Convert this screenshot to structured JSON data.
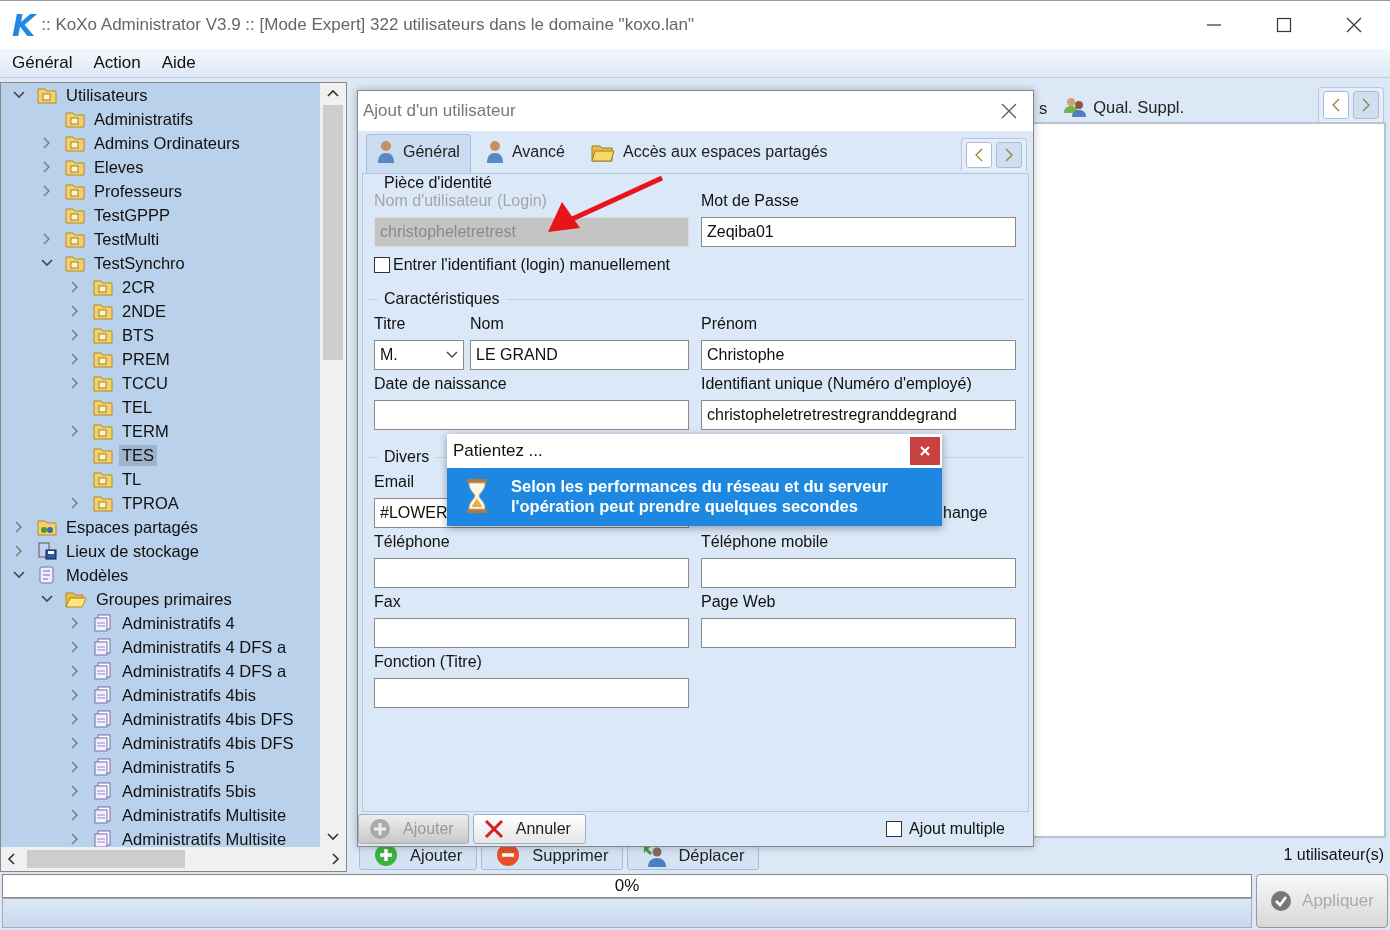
{
  "window": {
    "logo": "K",
    "title": ":: KoXo Administrator V3.9 :: [Mode Expert] 322 utilisateurs dans le domaine \"koxo.lan\""
  },
  "menu": [
    "Général",
    "Action",
    "Aide"
  ],
  "tree": [
    {
      "label": "Utilisateurs",
      "kind": "ou",
      "has_children": true,
      "expanded": true,
      "selected": false,
      "children": [
        {
          "label": "Administratifs",
          "kind": "ou",
          "has_children": false,
          "selected": false
        },
        {
          "label": "Admins Ordinateurs",
          "kind": "ou",
          "has_children": true,
          "expanded": false,
          "selected": false
        },
        {
          "label": "Eleves",
          "kind": "ou",
          "has_children": true,
          "expanded": false,
          "selected": false
        },
        {
          "label": "Professeurs",
          "kind": "ou",
          "has_children": true,
          "expanded": false,
          "selected": false
        },
        {
          "label": "TestGPPP",
          "kind": "ou",
          "has_children": false,
          "selected": false
        },
        {
          "label": "TestMulti",
          "kind": "ou",
          "has_children": true,
          "expanded": false,
          "selected": false
        },
        {
          "label": "TestSynchro",
          "kind": "ou",
          "has_children": true,
          "expanded": true,
          "selected": false,
          "children": [
            {
              "label": "2CR",
              "kind": "ou",
              "has_children": true,
              "expanded": false,
              "selected": false
            },
            {
              "label": "2NDE",
              "kind": "ou",
              "has_children": true,
              "expanded": false,
              "selected": false
            },
            {
              "label": "BTS",
              "kind": "ou",
              "has_children": true,
              "expanded": false,
              "selected": false
            },
            {
              "label": "PREM",
              "kind": "ou",
              "has_children": true,
              "expanded": false,
              "selected": false
            },
            {
              "label": "TCCU",
              "kind": "ou",
              "has_children": true,
              "expanded": false,
              "selected": false
            },
            {
              "label": "TEL",
              "kind": "ou",
              "has_children": false,
              "selected": false
            },
            {
              "label": "TERM",
              "kind": "ou",
              "has_children": true,
              "expanded": false,
              "selected": false
            },
            {
              "label": "TES",
              "kind": "ou",
              "has_children": false,
              "selected": true
            },
            {
              "label": "TL",
              "kind": "ou",
              "has_children": false,
              "selected": false
            },
            {
              "label": "TPROA",
              "kind": "ou",
              "has_children": true,
              "expanded": false,
              "selected": false
            }
          ]
        }
      ]
    },
    {
      "label": "Espaces partagés",
      "kind": "shares",
      "has_children": true,
      "expanded": false,
      "selected": false
    },
    {
      "label": "Lieux de stockage",
      "kind": "storage",
      "has_children": true,
      "expanded": false,
      "selected": false
    },
    {
      "label": "Modèles",
      "kind": "models",
      "has_children": true,
      "expanded": true,
      "selected": false,
      "children": [
        {
          "label": "Groupes primaires",
          "kind": "folder",
          "has_children": true,
          "expanded": true,
          "selected": false,
          "children": [
            {
              "label": "Administratifs 4",
              "kind": "template",
              "has_children": true,
              "expanded": false,
              "selected": false
            },
            {
              "label": "Administratifs 4 DFS a",
              "kind": "template",
              "has_children": true,
              "expanded": false,
              "selected": false
            },
            {
              "label": "Administratifs 4 DFS a",
              "kind": "template",
              "has_children": true,
              "expanded": false,
              "selected": false
            },
            {
              "label": "Administratifs 4bis",
              "kind": "template",
              "has_children": true,
              "expanded": false,
              "selected": false
            },
            {
              "label": "Administratifs 4bis DFS",
              "kind": "template",
              "has_children": true,
              "expanded": false,
              "selected": false
            },
            {
              "label": "Administratifs 4bis DFS",
              "kind": "template",
              "has_children": true,
              "expanded": false,
              "selected": false
            },
            {
              "label": "Administratifs 5",
              "kind": "template",
              "has_children": true,
              "expanded": false,
              "selected": false
            },
            {
              "label": "Administratifs 5bis",
              "kind": "template",
              "has_children": true,
              "expanded": false,
              "selected": false
            },
            {
              "label": "Administratifs Multisite",
              "kind": "template",
              "has_children": true,
              "expanded": false,
              "selected": false
            },
            {
              "label": "Administratifs Multisite",
              "kind": "template",
              "has_children": true,
              "expanded": false,
              "selected": false
            }
          ]
        }
      ]
    }
  ],
  "main_panel": {
    "tabs": [
      {
        "label": "s",
        "kind": "plain"
      },
      {
        "label": "Qual. Suppl.",
        "kind": "people"
      }
    ],
    "buttons": [
      {
        "label": "Ajouter",
        "kind": "add"
      },
      {
        "label": "Supprimer",
        "kind": "delete"
      },
      {
        "label": "Déplacer",
        "kind": "move"
      }
    ],
    "count": "1 utilisateur(s)"
  },
  "progress": {
    "level": 0,
    "text": "0%"
  },
  "apply_button": {
    "label": "Appliquer",
    "disabled": true
  },
  "dialog": {
    "title": "Ajout d'un utilisateur",
    "tabs": [
      {
        "label": "Général",
        "kind": "user",
        "selected": true
      },
      {
        "label": "Avancé",
        "kind": "user",
        "selected": false
      },
      {
        "label": "Accès aux espaces partagés",
        "kind": "folder",
        "selected": false
      }
    ],
    "sections": [
      {
        "title": "Pièce d'identité",
        "fields": [
          {
            "kind": "text",
            "label": "Nom d'utilisateur (Login)",
            "value": "christopheletretrest",
            "disabled": true
          },
          {
            "kind": "text",
            "label": "Mot de Passe",
            "value": "Zeqiba01",
            "disabled": false
          },
          {
            "kind": "checkbox",
            "label": "Entrer l'identifiant (login) manuellement",
            "checked": false
          }
        ]
      },
      {
        "title": "Caractéristiques",
        "fields": [
          {
            "kind": "select",
            "label": "Titre",
            "value": "M."
          },
          {
            "kind": "text",
            "label": "Nom",
            "value": "LE GRAND",
            "disabled": false
          },
          {
            "kind": "text",
            "label": "Prénom",
            "value": "Christophe",
            "disabled": false
          },
          {
            "kind": "text",
            "label": "Date de naissance",
            "disabled": false
          },
          {
            "kind": "text",
            "label": "Identifiant unique (Numéro d'employé)",
            "value": "christopheletretrestregranddegrand",
            "disabled": false
          }
        ]
      },
      {
        "title": "Divers",
        "fields": [
          {
            "kind": "text",
            "label": "Email",
            "value": "#LOWER",
            "disabled": false
          },
          {
            "kind": "note",
            "label": "hange"
          },
          {
            "kind": "text",
            "label": "Téléphone",
            "disabled": false
          },
          {
            "kind": "text",
            "label": "Téléphone mobile",
            "disabled": false
          },
          {
            "kind": "text",
            "label": "Fax",
            "disabled": false
          },
          {
            "kind": "text",
            "label": "Page Web",
            "disabled": false
          },
          {
            "kind": "text",
            "label": "Fonction (Titre)",
            "disabled": false
          }
        ]
      }
    ],
    "buttons": [
      {
        "label": "Ajouter",
        "kind": "add",
        "disabled": true
      },
      {
        "label": "Annuler",
        "kind": "cancel",
        "disabled": false
      }
    ],
    "multiple": {
      "label": "Ajout multiple",
      "checked": false
    }
  },
  "popup": {
    "title": "Patientez ...",
    "message": "Selon les performances du réseau et du serveur\nl'opération peut prendre quelques secondes"
  }
}
